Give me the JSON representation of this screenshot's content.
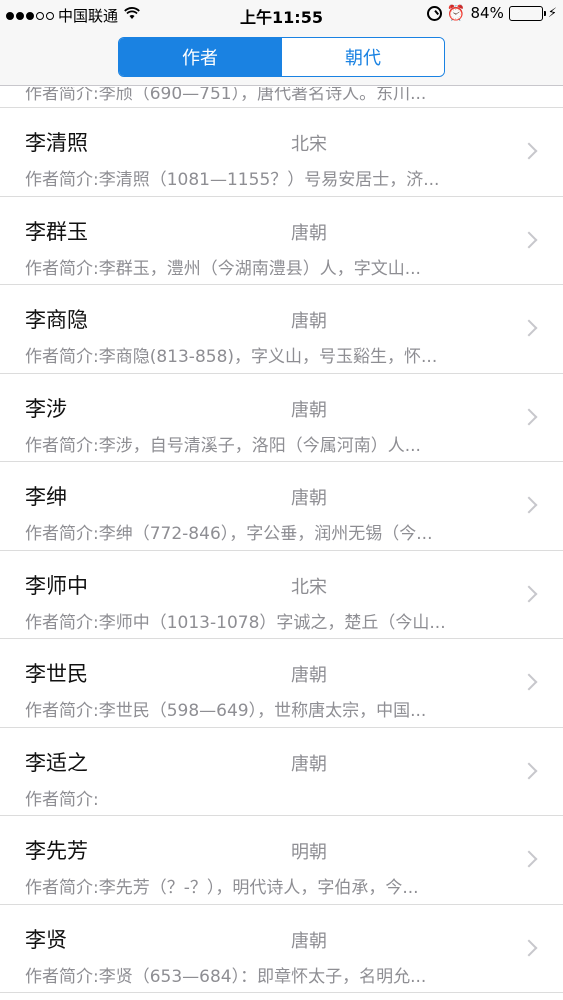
{
  "status_bar": {
    "carrier": "中国联通",
    "time": "上午11:55",
    "battery": "84%",
    "battery_level": 0.84,
    "icons": [
      "signal-dots",
      "wifi-icon",
      "orientation-lock-icon",
      "alarm-icon",
      "battery-icon",
      "charging-icon"
    ]
  },
  "segmented": {
    "tabs": [
      {
        "label": "作者",
        "active": true
      },
      {
        "label": "朝代",
        "active": false
      }
    ]
  },
  "list": {
    "partial_desc": "作者简介:李颀（690—751），唐代著名诗人。东川...",
    "items": [
      {
        "name": "李清照",
        "dynasty": "北宋",
        "desc": "作者简介:李清照（1081—1155？）号易安居士，济..."
      },
      {
        "name": "李群玉",
        "dynasty": "唐朝",
        "desc": "作者简介:李群玉，澧州（今湖南澧县）人，字文山..."
      },
      {
        "name": "李商隐",
        "dynasty": "唐朝",
        "desc": "作者简介:李商隐(813-858)，字义山，号玉谿生，怀..."
      },
      {
        "name": "李涉",
        "dynasty": "唐朝",
        "desc": "作者简介:李涉，自号清溪子，洛阳（今属河南）人..."
      },
      {
        "name": "李绅",
        "dynasty": "唐朝",
        "desc": "作者简介:李绅（772-846），字公垂，润州无锡（今..."
      },
      {
        "name": "李师中",
        "dynasty": "北宋",
        "desc": "作者简介:李师中（1013-1078）字诚之，楚丘（今山..."
      },
      {
        "name": "李世民",
        "dynasty": "唐朝",
        "desc": "作者简介:李世民（598—649），世称唐太宗，中国..."
      },
      {
        "name": "李适之",
        "dynasty": "唐朝",
        "desc": "作者简介:"
      },
      {
        "name": "李先芳",
        "dynasty": "明朝",
        "desc": "作者简介:李先芳（？-？），明代诗人，字伯承，今..."
      },
      {
        "name": "李贤",
        "dynasty": "唐朝",
        "desc": "作者简介:李贤（653—684）：即章怀太子，名明允..."
      }
    ]
  }
}
